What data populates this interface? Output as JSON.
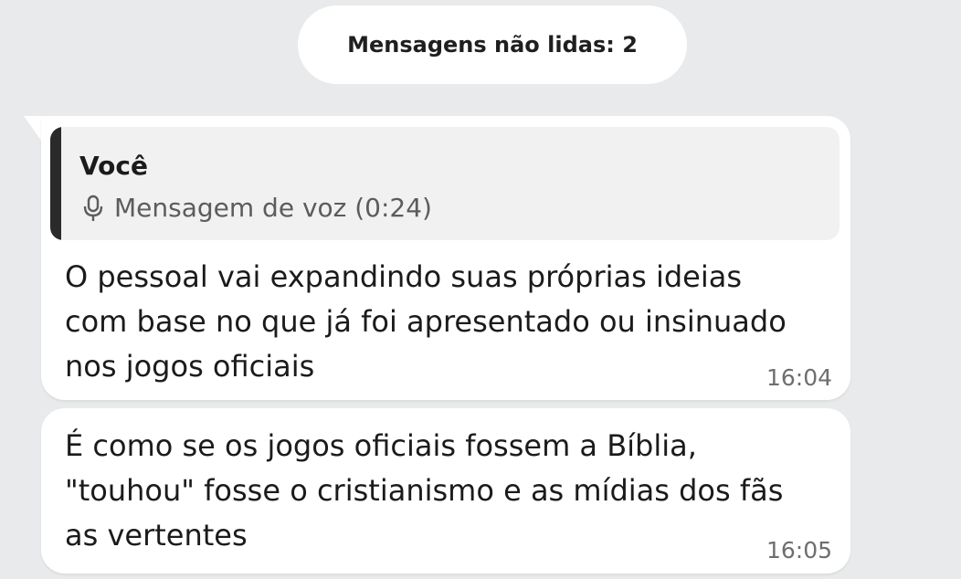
{
  "unread_banner": {
    "label": "Mensagens não lidas: 2"
  },
  "messages": [
    {
      "reply_to": {
        "author": "Você",
        "icon": "microphone-icon",
        "preview": "Mensagem de voz (0:24)"
      },
      "text": "O pessoal vai expandindo suas próprias ideias com base no que já foi apresentado ou insinuado nos jogos oficiais",
      "time": "16:04"
    },
    {
      "text": "É como se os jogos oficiais fossem a Bíblia, \"touhou\" fosse o cristianismo e as mídias dos fãs as vertentes",
      "time": "16:05"
    }
  ],
  "colors": {
    "background": "#e9eaeb",
    "bubble": "#ffffff",
    "quote_background": "#f1f1f2",
    "quote_bar": "#2a2a2a",
    "timestamp": "#6e6e6e"
  }
}
